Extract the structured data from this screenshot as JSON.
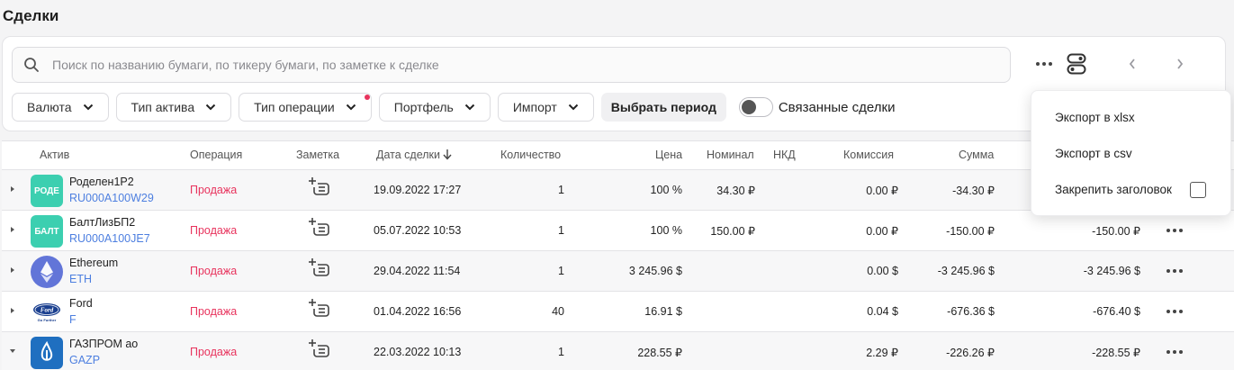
{
  "page": {
    "title": "Сделки"
  },
  "search": {
    "placeholder": "Поиск по названию бумаги, по тикеру бумаги, по заметке к сделке"
  },
  "filters": [
    {
      "label": "Валюта"
    },
    {
      "label": "Тип актива"
    },
    {
      "label": "Тип операции",
      "badge": true
    },
    {
      "label": "Портфель"
    },
    {
      "label": "Импорт"
    }
  ],
  "period_label": "Выбрать период",
  "linked": {
    "label": "Связанные сделки",
    "on": false
  },
  "menu": {
    "export_xlsx": "Экспорт в xlsx",
    "export_csv": "Экспорт в csv",
    "pin_header": "Закрепить заголовок",
    "pin_checked": false
  },
  "columns": {
    "asset": "Актив",
    "operation": "Операция",
    "note": "Заметка",
    "date": "Дата сделки",
    "quantity": "Количество",
    "price": "Цена",
    "nominal": "Номинал",
    "nkd": "НКД",
    "commission": "Комиссия",
    "sum": "Сумма"
  },
  "rows": [
    {
      "name": "Роделен1Р2",
      "ticker": "RU000A100W29",
      "logo_text": "РОДЕ",
      "logo_color": "#3ccfb0",
      "operation": "Продажа",
      "date": "19.09.2022 17:27",
      "quantity": "1",
      "price": "100 %",
      "nominal": "34.30 ₽",
      "nkd": "",
      "commission": "0.00 ₽",
      "sum": "-34.30 ₽",
      "total": "",
      "expanded": false
    },
    {
      "name": "БалтЛизБП2",
      "ticker": "RU000A100JE7",
      "logo_text": "БАЛТ",
      "logo_color": "#3ccfb0",
      "operation": "Продажа",
      "date": "05.07.2022 10:53",
      "quantity": "1",
      "price": "100 %",
      "nominal": "150.00 ₽",
      "nkd": "",
      "commission": "0.00 ₽",
      "sum": "-150.00 ₽",
      "total": "-150.00 ₽",
      "expanded": false
    },
    {
      "name": "Ethereum",
      "ticker": "ETH",
      "logo_text": "",
      "logo_color": "#6275d8",
      "operation": "Продажа",
      "date": "29.04.2022 11:54",
      "quantity": "1",
      "price": "3 245.96 $",
      "nominal": "",
      "nkd": "",
      "commission": "0.00 $",
      "sum": "-3 245.96 $",
      "total": "-3 245.96 $",
      "expanded": false
    },
    {
      "name": "Ford",
      "ticker": "F",
      "logo_text": "",
      "logo_color": "#ffffff",
      "operation": "Продажа",
      "date": "01.04.2022 16:56",
      "quantity": "40",
      "price": "16.91 $",
      "nominal": "",
      "nkd": "",
      "commission": "0.04 $",
      "sum": "-676.36 $",
      "total": "-676.40 $",
      "expanded": false
    },
    {
      "name": "ГАЗПРОМ ао",
      "ticker": "GAZP",
      "logo_text": "",
      "logo_color": "#1f6fc0",
      "operation": "Продажа",
      "date": "22.03.2022 10:13",
      "quantity": "1",
      "price": "228.55 ₽",
      "nominal": "",
      "nkd": "",
      "commission": "2.29 ₽",
      "sum": "-226.26 ₽",
      "total": "-228.55 ₽",
      "expanded": true
    }
  ]
}
